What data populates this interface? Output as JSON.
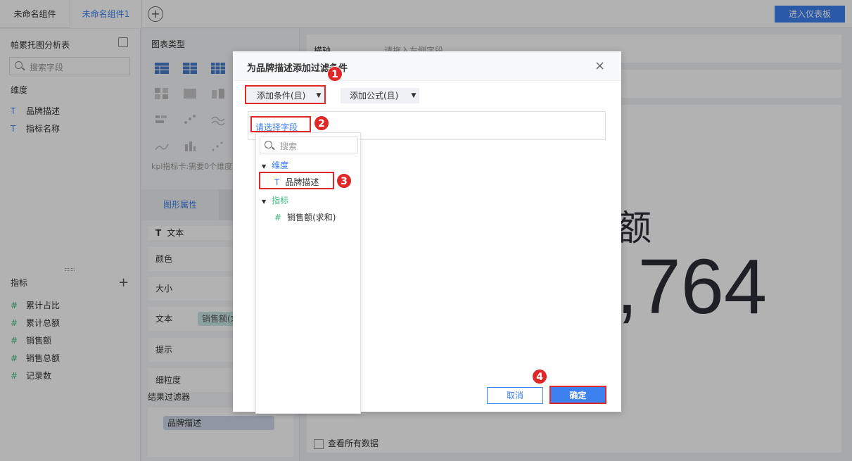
{
  "tabs": [
    {
      "label": "未命名组件"
    },
    {
      "label": "未命名组件1"
    }
  ],
  "add_tab": "+",
  "enter_dashboard": "进入仪表板",
  "left": {
    "title": "帕累托图分析表",
    "search_placeholder": "搜索字段",
    "dimension_heading": "维度",
    "dimensions": [
      {
        "icon": "T",
        "label": "品牌描述"
      },
      {
        "icon": "T",
        "label": "指标名称"
      }
    ],
    "indicator_heading": "指标",
    "indicators": [
      {
        "icon": "#",
        "label": "累计占比"
      },
      {
        "icon": "#",
        "label": "累计总额"
      },
      {
        "icon": "#",
        "label": "销售额"
      },
      {
        "icon": "#",
        "label": "销售总额"
      },
      {
        "icon": "#",
        "label": "记录数"
      }
    ]
  },
  "middle": {
    "chart_type_label": "图表类型",
    "kpi_note": "kpi指标卡:需要0个维度",
    "graphic_tab": "图形属性",
    "text_label": "文本",
    "props": {
      "color": "颜色",
      "size": "大小",
      "text": "文本",
      "tip": "提示",
      "granularity": "细粒度"
    },
    "text_pill": "销售额(求和)",
    "result_filter_label": "结果过滤器",
    "result_filter_pill": "品牌描述"
  },
  "right": {
    "axis_label": "横轴",
    "axis_placeholder": "请拖入左侧字段",
    "big_number": ",764",
    "big_char": "额",
    "view_all": "查看所有数据"
  },
  "dialog": {
    "title": "为品牌描述添加过滤条件",
    "close": "×",
    "add_condition": "添加条件(且)",
    "add_formula": "添加公式(且)",
    "select_field": "请选择字段",
    "cancel": "取消",
    "ok": "确定"
  },
  "popup": {
    "search_placeholder": "搜索",
    "dimension_group": "维度",
    "dimension_item": "品牌描述",
    "indicator_group": "指标",
    "indicator_item": "销售额(求和)"
  },
  "badges": [
    "1",
    "2",
    "3",
    "4"
  ],
  "colors": {
    "accent": "#3d80f0",
    "annotation": "#e02828",
    "indicator": "#3db87e"
  }
}
